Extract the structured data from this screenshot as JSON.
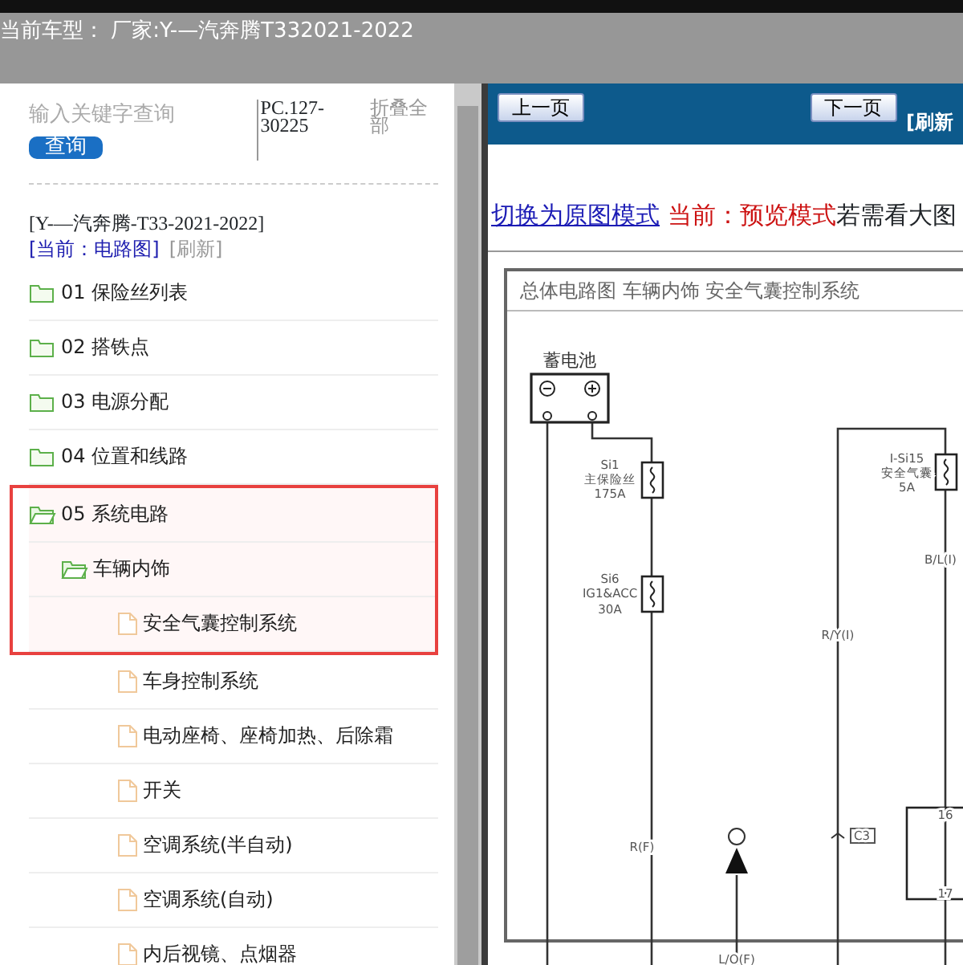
{
  "header": {
    "title": "当前车型： 厂家:Y-—汽奔腾T332021-2022"
  },
  "sidebar": {
    "search": {
      "placeholder": "输入关键字查询",
      "button": "查询"
    },
    "code": "PC.127-30225",
    "collapse_all": "折叠全部",
    "model": "[Y-—汽奔腾-T33-2021-2022]",
    "current": "[当前：电路图]",
    "refresh": "[刷新]",
    "tree": [
      {
        "label": "01 保险丝列表",
        "kind": "folder",
        "expanded": false,
        "highlighted": false
      },
      {
        "label": "02 搭铁点",
        "kind": "folder",
        "expanded": false,
        "highlighted": false
      },
      {
        "label": "03 电源分配",
        "kind": "folder",
        "expanded": false,
        "highlighted": false
      },
      {
        "label": "04 位置和线路",
        "kind": "folder",
        "expanded": false,
        "highlighted": false
      },
      {
        "label": "05 系统电路",
        "kind": "folder",
        "expanded": true,
        "highlighted": true,
        "children": [
          {
            "label": "车辆内饰",
            "kind": "folder",
            "expanded": true,
            "highlighted": true,
            "children": [
              {
                "label": "安全气囊控制系统",
                "kind": "page",
                "highlighted": true
              },
              {
                "label": "车身控制系统",
                "kind": "page",
                "highlighted": false
              },
              {
                "label": "电动座椅、座椅加热、后除霜",
                "kind": "page",
                "highlighted": false
              },
              {
                "label": "开关",
                "kind": "page",
                "highlighted": false
              },
              {
                "label": "空调系统(半自动)",
                "kind": "page",
                "highlighted": false
              },
              {
                "label": "空调系统(自动)",
                "kind": "page",
                "highlighted": false
              },
              {
                "label": "内后视镜、点烟器",
                "kind": "page",
                "highlighted": false
              }
            ]
          }
        ]
      }
    ]
  },
  "viewer": {
    "prev": "上一页",
    "next": "下一页",
    "refresh": "[刷新",
    "mode_link": "切换为原图模式",
    "mode_current": "当前：预览模式",
    "mode_hint": "若需看大图",
    "diagram_title": "总体电路图  车辆内饰  安全气囊控制系统",
    "labels": [
      {
        "text": "蓄电池",
        "kind": "title"
      },
      {
        "text": "Si1",
        "kind": "small"
      },
      {
        "text": "主保险丝",
        "kind": "small"
      },
      {
        "text": "175A",
        "kind": "small"
      },
      {
        "text": "Si6",
        "kind": "small"
      },
      {
        "text": "IG1&ACC",
        "kind": "small"
      },
      {
        "text": "30A",
        "kind": "small"
      },
      {
        "text": "I-Si15",
        "kind": "small"
      },
      {
        "text": "安全气囊",
        "kind": "small"
      },
      {
        "text": "5A",
        "kind": "small"
      },
      {
        "text": "B/L(I)",
        "kind": "small"
      },
      {
        "text": "R/Y(I)",
        "kind": "small"
      },
      {
        "text": "R(F)",
        "kind": "small"
      },
      {
        "text": "C3",
        "kind": "small"
      },
      {
        "text": "16",
        "kind": "small"
      },
      {
        "text": "17",
        "kind": "small"
      },
      {
        "text": "L/O(F)",
        "kind": "small"
      }
    ]
  }
}
